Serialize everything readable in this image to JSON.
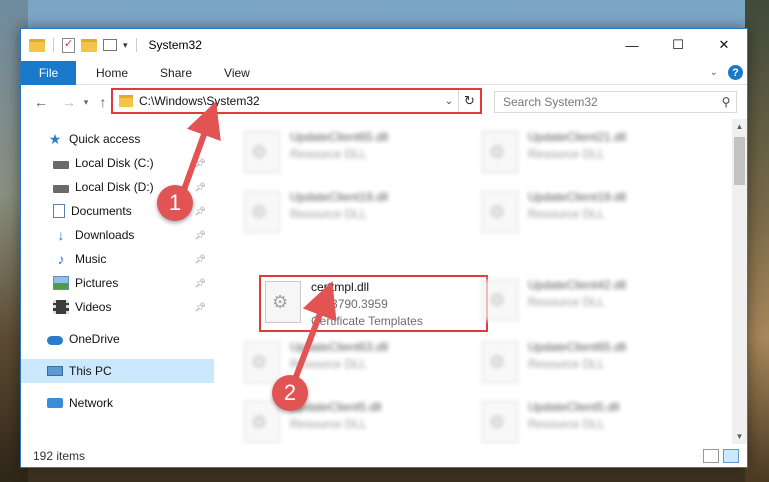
{
  "window": {
    "title": "System32",
    "controls": {
      "minimize": "—",
      "maximize": "☐",
      "close": "✕"
    }
  },
  "ribbon": {
    "tabs": [
      "File",
      "Home",
      "Share",
      "View"
    ],
    "help": "?"
  },
  "address": {
    "path": "C:\\Windows\\System32",
    "search_placeholder": "Search System32"
  },
  "nav": {
    "items": [
      {
        "label": "Quick access",
        "icon": "quick-access-star-icon"
      },
      {
        "label": "Local Disk (C:)",
        "icon": "disk-icon",
        "pinned": true
      },
      {
        "label": "Local Disk (D:)",
        "icon": "disk-icon",
        "pinned": true
      },
      {
        "label": "Documents",
        "icon": "documents-icon",
        "pinned": true
      },
      {
        "label": "Downloads",
        "icon": "downloads-icon",
        "pinned": true
      },
      {
        "label": "Music",
        "icon": "music-icon",
        "pinned": true
      },
      {
        "label": "Pictures",
        "icon": "pictures-icon",
        "pinned": true
      },
      {
        "label": "Videos",
        "icon": "videos-icon",
        "pinned": true
      },
      {
        "label": "OneDrive",
        "icon": "onedrive-icon"
      },
      {
        "label": "This PC",
        "icon": "this-pc-icon",
        "selected": true
      },
      {
        "label": "Network",
        "icon": "network-icon"
      }
    ]
  },
  "files": [
    {
      "name": "UpdateClient65.dll",
      "line2": "Resource DLL",
      "blurred": true
    },
    {
      "name": "UpdateClient21.dll",
      "line2": "Resource DLL",
      "blurred": true
    },
    {
      "name": "UpdateClient19.dll",
      "line2": "Resource DLL",
      "blurred": true
    },
    {
      "name": "UpdateClient19.dll",
      "line2": "Resource DLL",
      "blurred": true
    },
    {
      "name": "certtmpl.dll",
      "line2": "5.2.3790.3959",
      "line3": "Certificate Templates",
      "blurred": false
    },
    {
      "name": "UpdateClient42.dll",
      "line2": "Resource DLL",
      "blurred": true
    },
    {
      "name": "UpdateClient63.dll",
      "line2": "Resource DLL",
      "blurred": true
    },
    {
      "name": "UpdateClient65.dll",
      "line2": "Resource DLL",
      "blurred": true
    },
    {
      "name": "UpdateClient5.dll",
      "line2": "Resource DLL",
      "blurred": true
    },
    {
      "name": "UpdateClient5.dll",
      "line2": "Resource DLL",
      "blurred": true
    }
  ],
  "status": {
    "count": "192 items"
  },
  "callouts": {
    "one": "1",
    "two": "2"
  },
  "colors": {
    "accent": "#1979ca",
    "highlight": "#e03a3a",
    "selected": "#cce8ff"
  }
}
